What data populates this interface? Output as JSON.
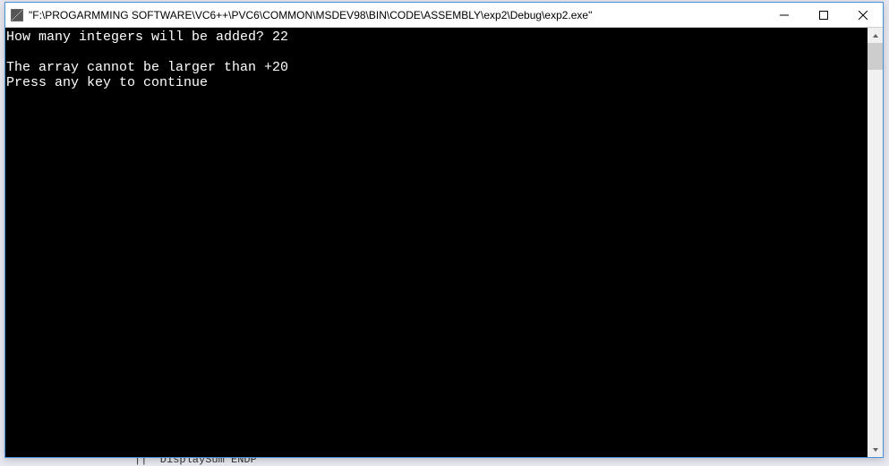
{
  "window": {
    "title": "\"F:\\PROGARMMING SOFTWARE\\VC6++\\PVC6\\COMMON\\MSDEV98\\BIN\\CODE\\ASSEMBLY\\exp2\\Debug\\exp2.exe\""
  },
  "console": {
    "lines": [
      "How many integers will be added? 22",
      "",
      "The array cannot be larger than +20",
      "Press any key to continue"
    ]
  },
  "background": {
    "code_fragment": "||  DisplaySum ENDP"
  }
}
